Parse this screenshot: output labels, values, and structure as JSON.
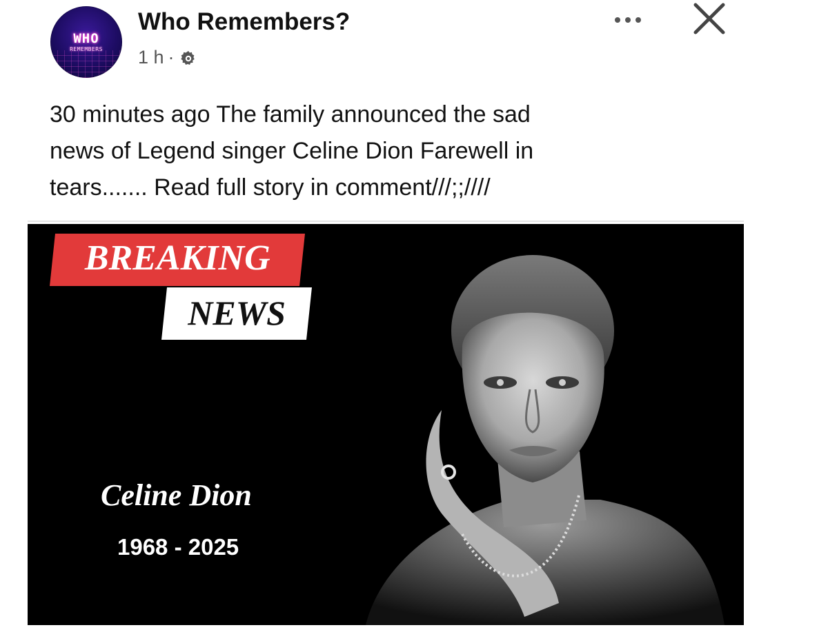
{
  "post": {
    "page_name": "Who Remembers?",
    "avatar": {
      "logo_main": "WHO",
      "logo_sub": "REMEMBERS"
    },
    "time": "1 h",
    "separator": "·",
    "audience_icon": "gear-icon",
    "more_icon": "more-dots-icon",
    "close_icon": "close-icon",
    "caption": "30 minutes ago  The family announced the sad\nnews of Legend singer Celine Dion  Farewell in\ntears....... Read full story in comment///;;////"
  },
  "image": {
    "badge_top": "BREAKING",
    "badge_bottom": "NEWS",
    "name": "Celine Dion",
    "years": "1968 - 2025",
    "colors": {
      "background": "#000000",
      "badge_red": "#e23a3a",
      "badge_white": "#ffffff"
    }
  }
}
